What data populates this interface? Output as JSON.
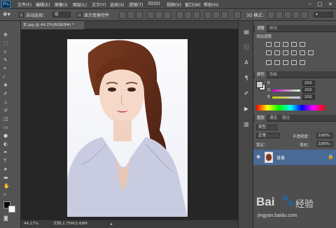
{
  "app": {
    "logo": "Ps"
  },
  "menu": [
    "文件(F)",
    "编辑(E)",
    "图像(I)",
    "图层(L)",
    "文字(Y)",
    "选择(S)",
    "滤镜(T)",
    "3D(D)",
    "视图(V)",
    "窗口(W)",
    "帮助(H)"
  ],
  "options": {
    "auto_select_label": "自动选择：",
    "auto_select_value": "组",
    "transform_label": "显示变换控件",
    "mode_3d_label": "3D 模式："
  },
  "document": {
    "tab_label": "女.jpg @ 44.2%(RGB/8#) *",
    "zoom": "44.17%",
    "doc_info": "文档:2.75M/2.68M"
  },
  "panels": {
    "adjust_tabs": [
      "调整",
      "样式"
    ],
    "adjust_title": "添加调整",
    "color_tabs": [
      "颜色",
      "色板"
    ],
    "color": {
      "r_label": "R",
      "g_label": "G",
      "b_label": "B",
      "r": "202",
      "g": "202",
      "b": "202",
      "swatch": "#cacaca"
    },
    "layers_tabs": [
      "图层",
      "通道",
      "路径"
    ],
    "layers_filter": "类型",
    "blend_mode": "正常",
    "opacity_label": "不透明度：",
    "opacity": "100%",
    "lock_label": "锁定：",
    "fill_label": "填充：",
    "fill": "100%",
    "layer_name": "背景"
  },
  "watermark": {
    "brand": "Bai",
    "brand2": "经验",
    "url": "jingyan.baidu.com"
  },
  "colors": {
    "accent": "#2f7fc0",
    "selected_layer": "#4a6a96"
  }
}
